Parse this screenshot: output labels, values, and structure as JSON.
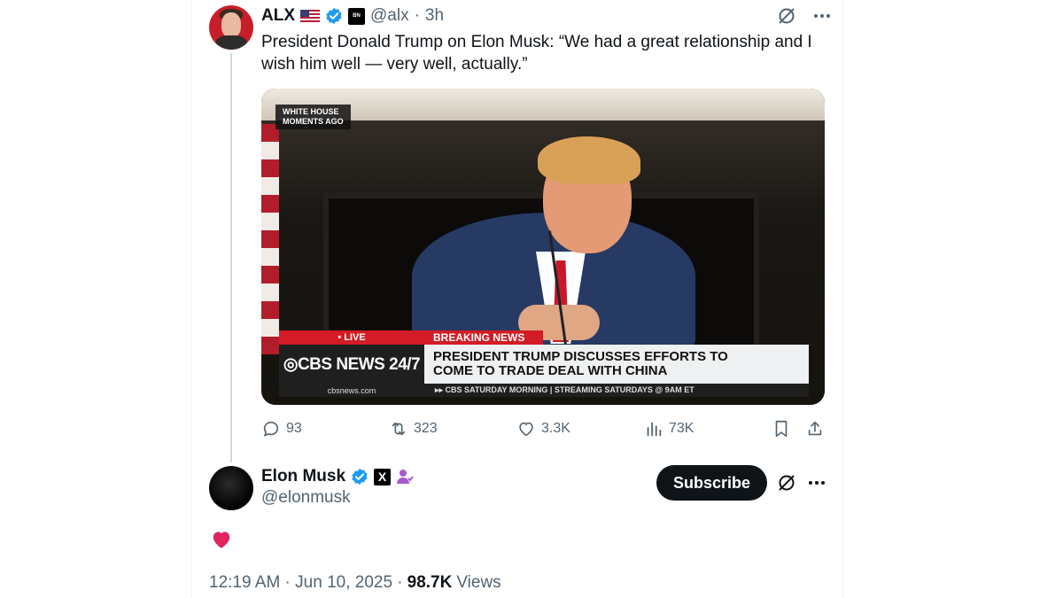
{
  "tweet": {
    "author_name": "ALX",
    "handle": "@alx",
    "separator": "·",
    "time": "3h",
    "text": "President Donald Trump on Elon Musk: “We had a great relationship and I wish him well — very well, actually.”",
    "affiliate_badge_text": "Breaking news",
    "media": {
      "corner_tag_line1": "WHITE HOUSE",
      "corner_tag_line2": "MOMENTS AGO",
      "live_label": "• LIVE",
      "breaking_label": "BREAKING NEWS",
      "network": "◎CBS NEWS 24/7",
      "headline_line1": "PRESIDENT TRUMP DISCUSSES EFFORTS TO",
      "headline_line2": "COME TO TRADE DEAL WITH CHINA",
      "site": "cbsnews.com",
      "ticker": "▸▸ CBS SATURDAY MORNING | STREAMING SATURDAYS @ 9AM ET"
    },
    "actions": {
      "replies": "93",
      "reposts": "323",
      "likes": "3.3K",
      "views": "73K"
    }
  },
  "reply": {
    "author_name": "Elon Musk",
    "handle": "@elonmusk",
    "x_badge": "X",
    "subscribe_label": "Subscribe",
    "emoji": "heart",
    "timestamp": "12:19 AM · Jun 10, 2025 ·",
    "view_count": "98.7K",
    "views_label": "Views"
  },
  "colors": {
    "verified_blue": "#1d9bf0",
    "muted_gray": "#536471",
    "heart_red": "#e0245e",
    "cbs_red": "#d31c25",
    "affiliate_purple": "#a95acd"
  }
}
